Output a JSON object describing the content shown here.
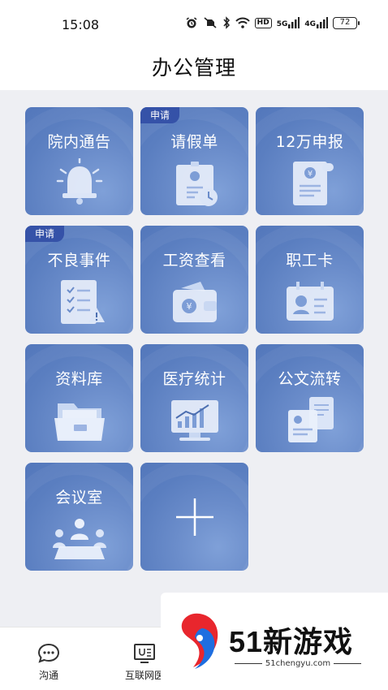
{
  "status_bar": {
    "time": "15:08",
    "network_5g": "5G",
    "network_4g": "4G",
    "hd": "HD",
    "battery": "72"
  },
  "header": {
    "title": "办公管理"
  },
  "tiles": [
    {
      "label": "院内通告",
      "badge": "",
      "icon": "bell-icon"
    },
    {
      "label": "请假单",
      "badge": "申请",
      "icon": "leave-form-icon"
    },
    {
      "label": "12万申报",
      "badge": "",
      "icon": "money-document-icon"
    },
    {
      "label": "不良事件",
      "badge": "申请",
      "icon": "checklist-warning-icon"
    },
    {
      "label": "工资查看",
      "badge": "",
      "icon": "wallet-icon"
    },
    {
      "label": "职工卡",
      "badge": "",
      "icon": "id-card-icon"
    },
    {
      "label": "资料库",
      "badge": "",
      "icon": "folder-icon"
    },
    {
      "label": "医疗统计",
      "badge": "",
      "icon": "monitor-chart-icon"
    },
    {
      "label": "公文流转",
      "badge": "",
      "icon": "documents-icon"
    },
    {
      "label": "会议室",
      "badge": "",
      "icon": "meeting-icon"
    },
    {
      "label": "",
      "badge": "",
      "icon": "plus-icon"
    }
  ],
  "bottom_nav": [
    {
      "label": "沟通",
      "icon": "chat-bubble-icon"
    },
    {
      "label": "互联网医",
      "icon": "monitor-stethoscope-icon"
    }
  ],
  "watermark": {
    "brand": "51新游戏",
    "url": "51chengyu.com"
  },
  "colors": {
    "tile": "#6182c4",
    "badge": "#3552a8",
    "page_bg": "#eeeff3"
  }
}
